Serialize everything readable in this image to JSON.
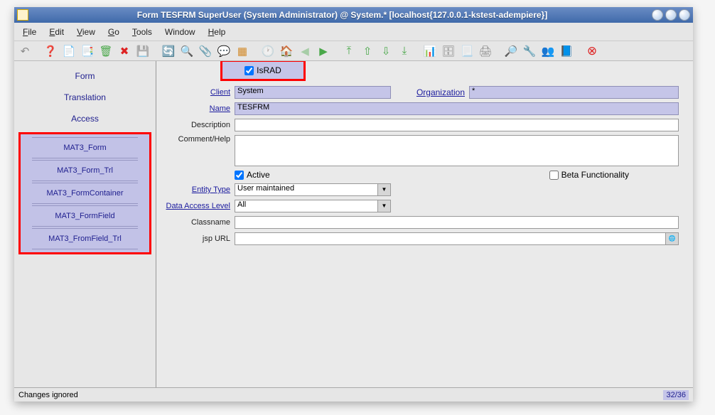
{
  "title": "Form  TESFRM  SuperUser (System Administrator) @ System.* [localhost{127.0.0.1-kstest-adempiere}]",
  "menu": {
    "file": "File",
    "edit": "Edit",
    "view": "View",
    "go": "Go",
    "tools": "Tools",
    "window": "Window",
    "help": "Help"
  },
  "sidebar": {
    "tabs": [
      "Form",
      "Translation",
      "Access"
    ],
    "items": [
      "MAT3_Form",
      "MAT3_Form_Trl",
      "MAT3_FormContainer",
      "MAT3_FormField",
      "MAT3_FromField_Trl"
    ]
  },
  "form": {
    "israd_label": "IsRAD",
    "client_label": "Client",
    "client_value": "System",
    "org_label": "Organization",
    "org_value": "*",
    "name_label": "Name",
    "name_value": "TESFRM",
    "desc_label": "Description",
    "desc_value": "",
    "comment_label": "Comment/Help",
    "comment_value": "",
    "active_label": "Active",
    "beta_label": "Beta Functionality",
    "entity_label": "Entity Type",
    "entity_value": "User maintained",
    "access_label": "Data Access Level",
    "access_value": "All",
    "class_label": "Classname",
    "class_value": "",
    "jsp_label": "jsp URL",
    "jsp_value": ""
  },
  "status": {
    "left": "Changes ignored",
    "right": "32/36"
  }
}
